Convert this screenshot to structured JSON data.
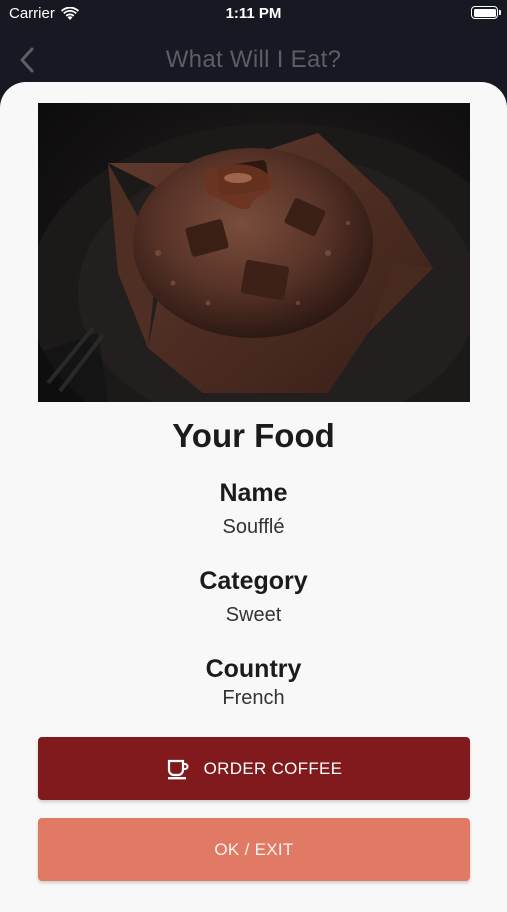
{
  "status_bar": {
    "carrier": "Carrier",
    "time": "1:11 PM",
    "icons": [
      "wifi-icon",
      "battery-icon"
    ]
  },
  "nav": {
    "title": "What Will I Eat?",
    "back_icon": "chevron-left-icon"
  },
  "food": {
    "heading": "Your Food",
    "name_label": "Name",
    "name_value": "Soufflé",
    "category_label": "Category",
    "category_value": "Sweet",
    "country_label": "Country",
    "country_value": "French",
    "photo": "chocolate-muffin-photo"
  },
  "actions": {
    "order_coffee_label": "ORDER COFFEE",
    "order_coffee_icon": "coffee-cup-icon",
    "exit_label": "OK / EXIT"
  },
  "colors": {
    "background": "#171922",
    "sheet": "#f8f8f8",
    "coffee_button": "#811a1d",
    "exit_button": "#e07a64"
  }
}
